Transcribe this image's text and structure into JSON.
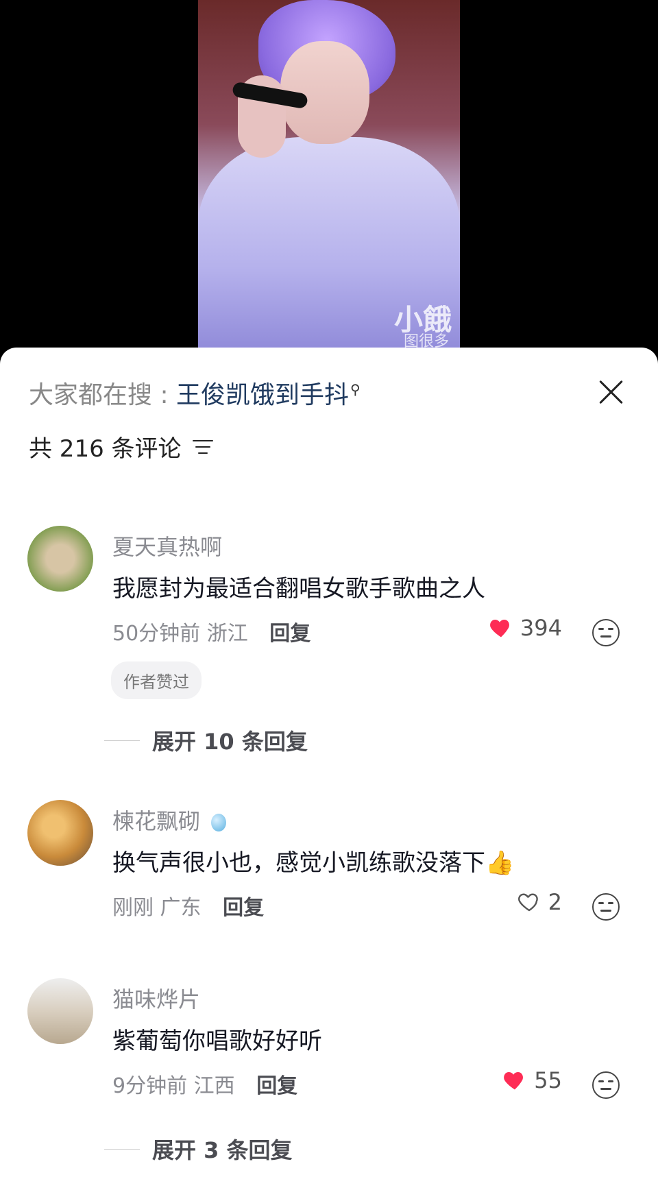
{
  "video": {
    "watermark": "小餓",
    "watermark_sub": "图很多"
  },
  "search_hint": {
    "prefix": "大家都在搜 : ",
    "term": "王俊凯饿到手抖"
  },
  "comments_header": {
    "count_label": "共 216 条评论"
  },
  "comments": [
    {
      "username": "夏天真热啊",
      "text": "我愿封为最适合翻唱女歌手歌曲之人",
      "time": "50分钟前",
      "location": "浙江",
      "reply_label": "回复",
      "likes": "394",
      "liked": true,
      "badge": "作者赞过",
      "expand_label": "展开 10 条回复",
      "avatar_color": "#7a9a4a"
    },
    {
      "username": "楝花飘砌",
      "username_suffix_icon": "balloon-icon",
      "text": "换气声很小也，感觉小凯练歌没落下👍",
      "time": "刚刚",
      "location": "广东",
      "reply_label": "回复",
      "likes": "2",
      "liked": false,
      "avatar_color": "#c98a3a"
    },
    {
      "username": "猫味烨片",
      "text": "紫葡萄你唱歌好好听",
      "time": "9分钟前",
      "location": "江西",
      "reply_label": "回复",
      "likes": "55",
      "liked": true,
      "expand_label": "展开 3 条回复",
      "avatar_color": "#d9cfc0"
    }
  ],
  "colors": {
    "accent_heart": "#fe2c55",
    "search_term": "#1f3a5f"
  }
}
